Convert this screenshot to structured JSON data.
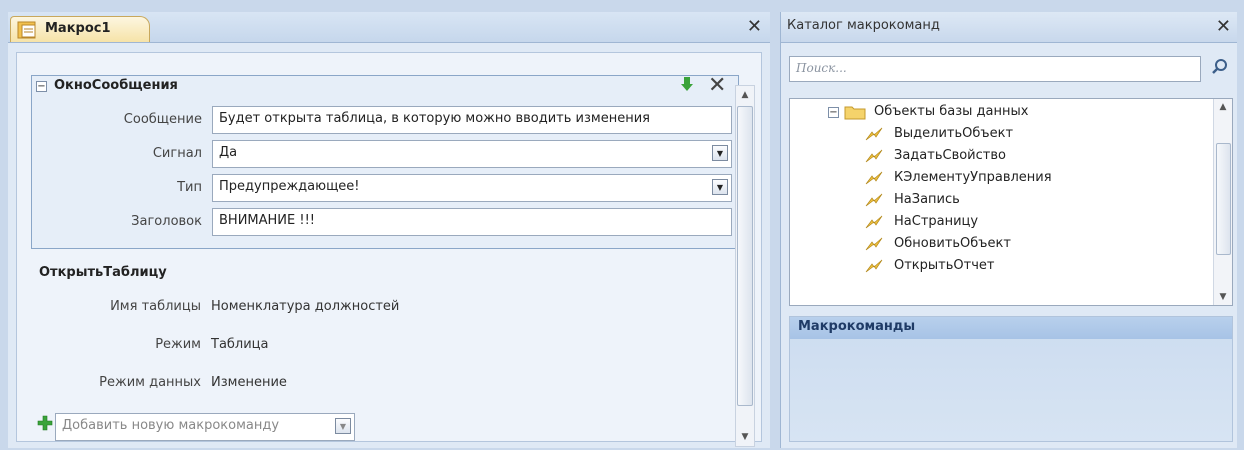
{
  "tab": {
    "title": "Макрос1"
  },
  "macro": {
    "action1": {
      "name": "ОкноСообщения",
      "args": [
        {
          "label": "Сообщение",
          "value": "Будет открыта таблица, в которую можно вводить изменения",
          "dropdown": false
        },
        {
          "label": "Сигнал",
          "value": "Да",
          "dropdown": true
        },
        {
          "label": "Тип",
          "value": "Предупреждающее!",
          "dropdown": true
        },
        {
          "label": "Заголовок",
          "value": "ВНИМАНИЕ !!!",
          "dropdown": false
        }
      ]
    },
    "action2": {
      "name": "ОткрытьТаблицу",
      "args": [
        {
          "label": "Имя таблицы",
          "value": "Номенклатура должностей"
        },
        {
          "label": "Режим",
          "value": "Таблица"
        },
        {
          "label": "Режим данных",
          "value": "Изменение"
        }
      ]
    },
    "add_action": {
      "value": "Добавить новую макрокоманду"
    }
  },
  "catalog": {
    "title": "Каталог макрокоманд",
    "search_placeholder": "Поиск...",
    "folder": "Объекты базы данных",
    "items": [
      "ВыделитьОбъект",
      "ЗадатьСвойство",
      "КЭлементуУправления",
      "НаЗапись",
      "НаСтраницу",
      "ОбновитьОбъект",
      "ОткрытьОтчет"
    ],
    "actions_panel_title": "Макрокоманды"
  },
  "colors": {
    "background": "#c9d8eb",
    "tab_active": "#f6e3a8",
    "panel_header": "#a7c3e6",
    "add_icon": "#3aa33a"
  },
  "icons": [
    "macro-tab-icon",
    "move-down-icon",
    "delete-icon",
    "dropdown-arrow-icon",
    "add-action-icon",
    "search-icon",
    "folder-icon",
    "lightning-icon"
  ]
}
